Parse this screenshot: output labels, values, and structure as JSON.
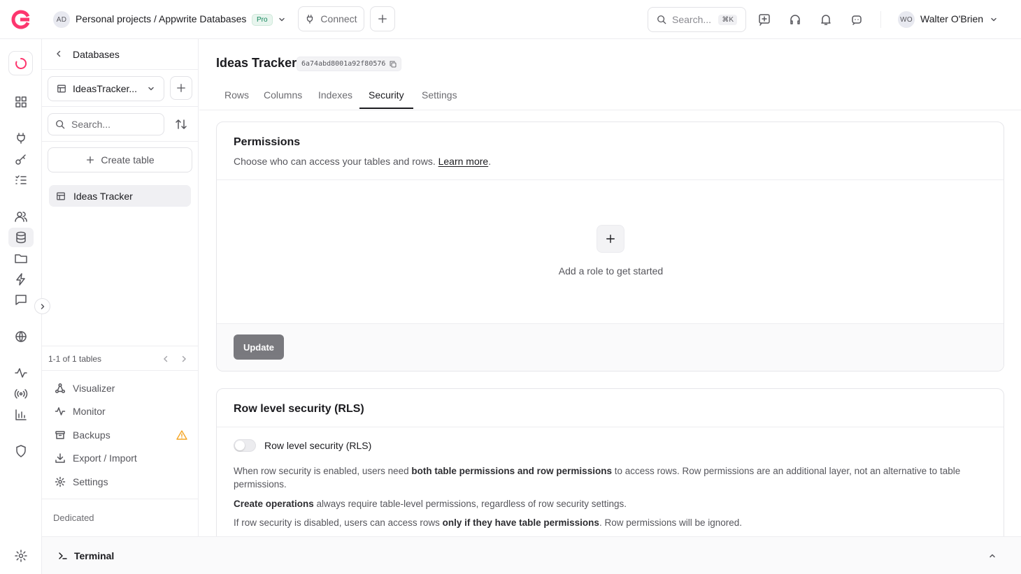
{
  "topbar": {
    "org_initials": "AD",
    "project_path": "Personal projects / Appwrite Databases",
    "plan_badge": "Pro",
    "connect_label": "Connect",
    "search_placeholder": "Search...",
    "search_shortcut": "⌘K",
    "user_initials": "WO",
    "user_name": "Walter O'Brien"
  },
  "sidepanel": {
    "back_title": "Databases",
    "table_select_value": "IdeasTracker...",
    "search_placeholder": "Search...",
    "create_table_label": "Create table",
    "tables": [
      {
        "label": "Ideas Tracker"
      }
    ],
    "pagination_text": "1-1 of 1 tables",
    "menu": [
      {
        "label": "Visualizer",
        "icon": "visualizer-icon"
      },
      {
        "label": "Monitor",
        "icon": "activity-icon"
      },
      {
        "label": "Backups",
        "icon": "archive-icon"
      },
      {
        "label": "Export / Import",
        "icon": "download-icon"
      },
      {
        "label": "Settings",
        "icon": "gear-icon"
      }
    ],
    "footer_label": "Dedicated"
  },
  "main": {
    "page_title": "Ideas Tracker",
    "table_id": "6a74abd8001a92f80576",
    "tabs": [
      "Rows",
      "Columns",
      "Indexes",
      "Security",
      "Settings"
    ],
    "active_tab": "Security",
    "permissions": {
      "title": "Permissions",
      "description": "Choose who can access your tables and rows.",
      "learn_more": "Learn more",
      "learn_more_suffix": ".",
      "empty_text": "Add a role to get started",
      "update_label": "Update"
    },
    "rls": {
      "title": "Row level security (RLS)",
      "toggle_label": "Row level security (RLS)",
      "para1_a": "When row security is enabled, users need ",
      "para1_b": "both table permissions and row permissions",
      "para1_c": " to access rows. Row permissions are an additional layer, not an alternative to table permissions.",
      "para2_a": "Create operations",
      "para2_b": " always require table-level permissions, regardless of row security settings.",
      "para3_a": "If row security is disabled, users can access rows ",
      "para3_b": "only if they have table permissions",
      "para3_c": ". Row permissions will be ignored."
    }
  },
  "terminal": {
    "label": "Terminal"
  },
  "colors": {
    "brand": "#fd366e",
    "active_tab_underline": "#1b1b1f",
    "update_button": "#6c6c71",
    "warning": "#f5a524"
  }
}
